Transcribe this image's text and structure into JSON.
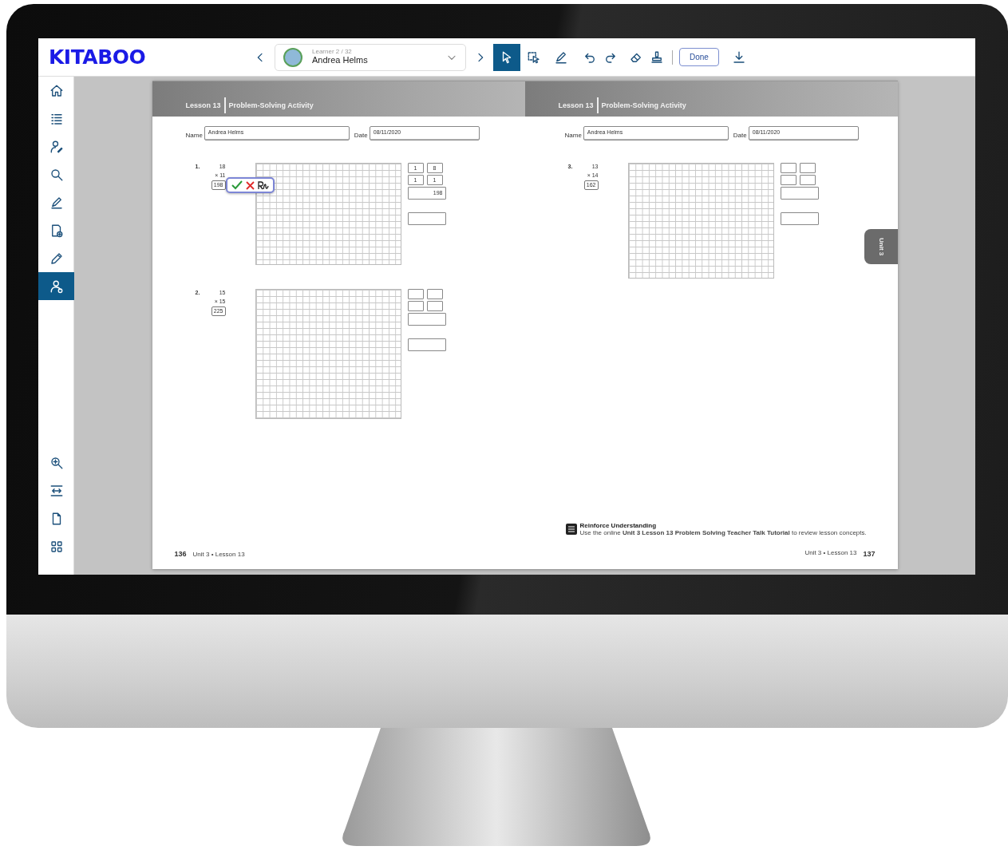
{
  "logo": "KITABOO",
  "toolbar": {
    "learner": {
      "counter": "Learner 2 / 32",
      "name": "Andrea Helms"
    },
    "tools": [
      {
        "kind": "cursor",
        "selected": true
      },
      {
        "kind": "selection",
        "selected": false
      },
      {
        "kind": "pen",
        "selected": false
      },
      {
        "kind": "undo",
        "selected": false
      },
      {
        "kind": "redo",
        "selected": false
      },
      {
        "kind": "eraser",
        "selected": false
      },
      {
        "kind": "stamp",
        "selected": false
      }
    ],
    "done_button": "Done"
  },
  "sidebar": {
    "items": [
      {
        "kind": "home",
        "selected": false
      },
      {
        "kind": "list",
        "selected": false
      },
      {
        "kind": "person",
        "selected": false
      },
      {
        "kind": "search",
        "selected": false
      },
      {
        "kind": "pen",
        "selected": false
      },
      {
        "kind": "note",
        "selected": false
      },
      {
        "kind": "pencil",
        "selected": false
      },
      {
        "kind": "user",
        "selected": true
      }
    ],
    "bottom_items": [
      {
        "kind": "zoom-in"
      },
      {
        "kind": "fit-width"
      },
      {
        "kind": "page"
      },
      {
        "kind": "grid"
      }
    ]
  },
  "pages": [
    {
      "lesson": "Lesson 13",
      "title": "Problem-Solving Activity",
      "name_label": "Name",
      "name_value": "Andrea Helms",
      "date_label": "Date",
      "date_value": "08/11/2020",
      "problems": [
        {
          "number": "1.",
          "factor_1": "18",
          "factor_2": "× 11",
          "answer": "198",
          "grader_open": true,
          "partials": [
            "1",
            "8",
            "1",
            "1"
          ],
          "product": "198"
        },
        {
          "number": "2.",
          "factor_1": "15",
          "factor_2": "× 15",
          "answer": "225",
          "grader_open": false
        }
      ],
      "page_number": "136",
      "footer": "Unit 3 • Lesson 13"
    },
    {
      "lesson": "Lesson 13",
      "title": "Problem-Solving Activity",
      "name_label": "Name",
      "name_value": "Andrea Helms",
      "date_label": "Date",
      "date_value": "08/11/2020",
      "problems": [
        {
          "number": "3.",
          "factor_1": "13",
          "factor_2": "× 14",
          "answer": "162",
          "grader_open": false
        }
      ],
      "side_tab": "Unit 3",
      "reinforce": {
        "title": "Reinforce Understanding",
        "text": "Use the online **Unit 3 Lesson 13 Problem Solving Teacher Talk Tutorial** to review lesson concepts."
      },
      "footer": "Unit 3 • Lesson 13",
      "page_number": "137"
    }
  ]
}
